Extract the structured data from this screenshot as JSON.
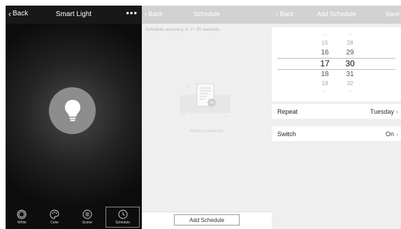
{
  "smart_light": {
    "back_label": "Back",
    "title": "Smart Light",
    "more_icon": "ellipsis-icon",
    "bulb_icon": "lightbulb-icon",
    "nav": [
      {
        "label": "White",
        "icon": "ring-icon"
      },
      {
        "label": "Color",
        "icon": "palette-icon"
      },
      {
        "label": "Scene",
        "icon": "list-circle-icon"
      },
      {
        "label": "Schedule",
        "icon": "clock-icon",
        "active": true
      }
    ]
  },
  "schedule": {
    "back_label": "Back",
    "title": "Schedule",
    "accuracy_text": "Schedule accuracy is -/+ 30 seconds",
    "empty_text": "Empty schedule list",
    "add_button": "Add Schedule"
  },
  "add_schedule": {
    "back_label": "Back",
    "title": "Add Schedule",
    "save_label": "Save",
    "hours": [
      "14",
      "15",
      "16",
      "17",
      "18",
      "19",
      "20"
    ],
    "minutes": [
      "27",
      "28",
      "29",
      "30",
      "31",
      "32",
      "33"
    ],
    "selected_hour": "17",
    "selected_minute": "30",
    "repeat_label": "Repeat",
    "repeat_value": "Tuesday",
    "switch_label": "Switch",
    "switch_value": "On"
  },
  "colors": {
    "dark_bg": "#0c0c0c",
    "bulb_circle": "#8d8d8d",
    "light_panel_bg": "#efefef",
    "topbar_disabled": "#d2d2d2"
  }
}
